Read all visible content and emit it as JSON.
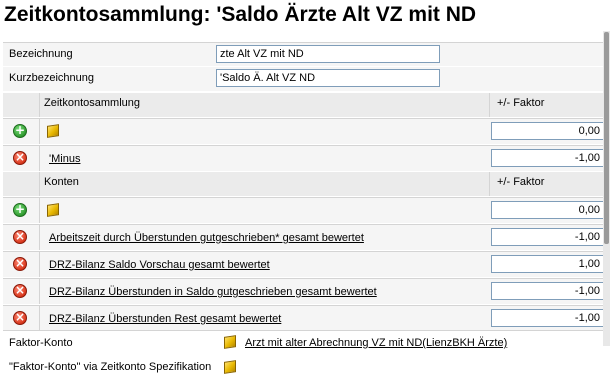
{
  "title": "Zeitkontosammlung: 'Saldo Ärzte Alt VZ mit ND",
  "bezeichnung": {
    "label": "Bezeichnung",
    "value": "zte Alt VZ mit ND"
  },
  "kurzbezeichnung": {
    "label": "Kurzbezeichnung",
    "value": "'Saldo Ä. Alt VZ ND"
  },
  "zeitkontosammlung": {
    "header": "Zeitkontosammlung",
    "factor_header": "+/- Faktor",
    "add_row_value": "0,00",
    "rows": [
      {
        "label": "'Minus",
        "factor": "-1,00"
      }
    ]
  },
  "konten": {
    "header": "Konten",
    "factor_header": "+/- Faktor",
    "add_row_value": "0,00",
    "rows": [
      {
        "label": "Arbeitszeit durch Überstunden gutgeschrieben* gesamt bewertet",
        "factor": "-1,00"
      },
      {
        "label": "DRZ-Bilanz Saldo Vorschau gesamt bewertet",
        "factor": "1,00"
      },
      {
        "label": "DRZ-Bilanz Überstunden in Saldo gutgeschrieben gesamt bewertet",
        "factor": "-1,00"
      },
      {
        "label": "DRZ-Bilanz Überstunden Rest gesamt bewertet",
        "factor": "-1,00"
      }
    ]
  },
  "faktor_konto": {
    "label": "Faktor-Konto",
    "link": "Arzt mit alter Abrechnung VZ mit ND(LienzBKH Ärzte)"
  },
  "faktor_konto_spez": {
    "label": "\"Faktor-Konto\" via Zeitkonto Spezifikation"
  },
  "colors": {
    "bg": "#ffffff",
    "header_bg": "#ebebeb",
    "row_bg": "#f5f5f5",
    "add": "#2f9a2f",
    "delete": "#d8361b",
    "cube": "#e8b800"
  },
  "icons": {
    "add": "plus-circle-icon",
    "delete": "x-circle-icon",
    "entity": "cube-icon"
  }
}
